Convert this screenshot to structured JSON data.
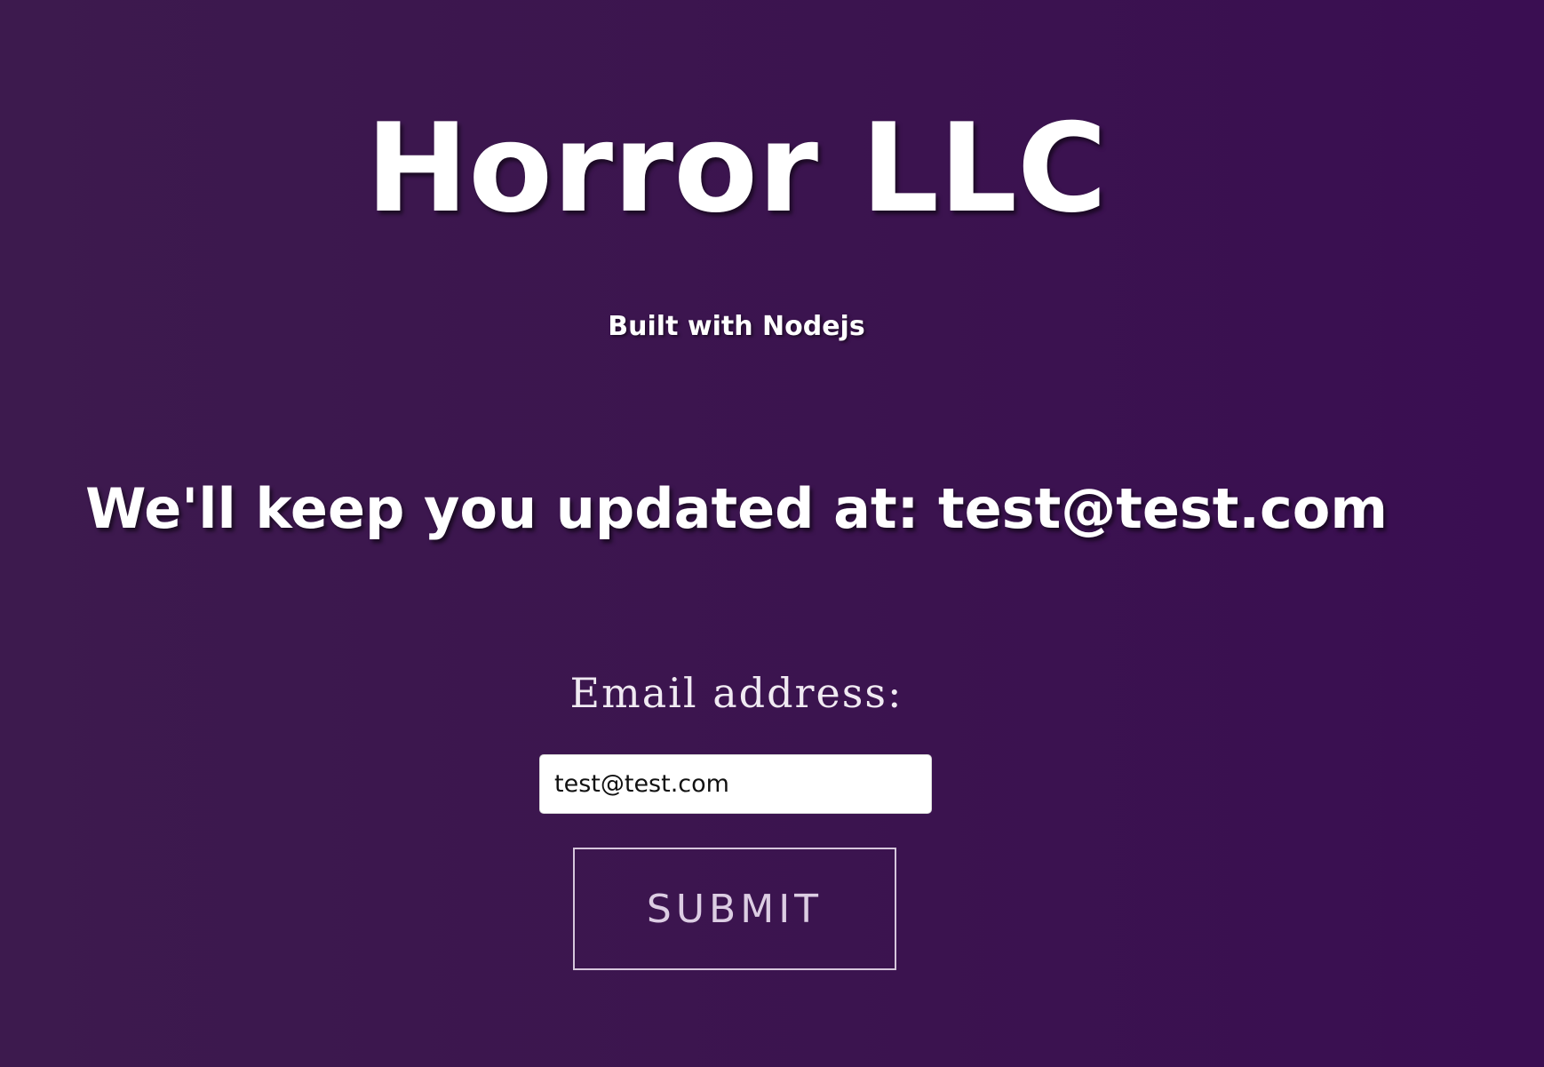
{
  "header": {
    "title": "Horror LLC",
    "subtitle": "Built with Nodejs"
  },
  "main": {
    "update_message": "We'll keep you updated at: test@test.com"
  },
  "form": {
    "email_label": "Email address:",
    "email_value": "test@test.com",
    "submit_label": "SUBMIT"
  },
  "colors": {
    "background_left": "#3d1a4e",
    "background_right": "#3a0e52",
    "text": "#ffffff",
    "button_border": "#d6c6dc"
  }
}
